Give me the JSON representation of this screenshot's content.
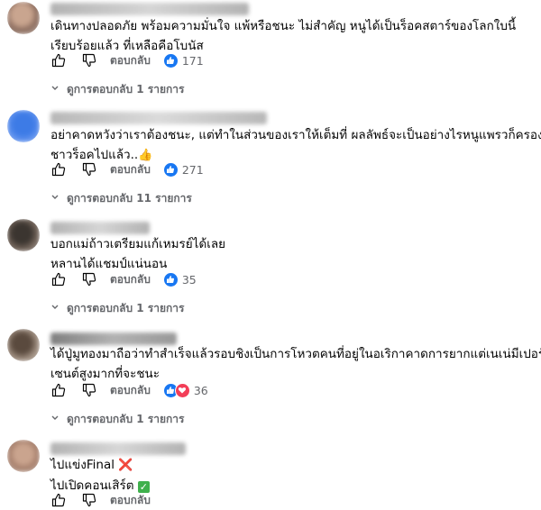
{
  "reply_label": "ตอบกลับ",
  "comments": [
    {
      "text_lines": [
        "เดินทางปลอดภัย พร้อมความมั่นใจ แพ้หรือชนะ ไม่สำคัญ หนูได้เป็นร็อคสตาร์ของโลกใบนี้",
        "เรียบร้อยแล้ว ที่เหลือคือโบนัส"
      ],
      "reaction_count": "171",
      "view_replies": "ดูการตอบกลับ 1 รายการ"
    },
    {
      "text_lines": [
        "อย่าคาดหวังว่าเราต้องชนะ, แต่ทำในส่วนของเราให้เต็มที่ ผลลัพธ์จะเป็นอย่างไรหนูแพรวก็ครองใจ",
        "ชาวร็อคไปแล้ว.."
      ],
      "reaction_count": "271",
      "view_replies": "ดูการตอบกลับ 11 รายการ"
    },
    {
      "text_lines": [
        "บอกแม่ถ้าวเตรียมแก้เหมรย์ได้เลย",
        "หลานได้แชมป์แน่นอน"
      ],
      "reaction_count": "35",
      "view_replies": "ดูการตอบกลับ 1 รายการ"
    },
    {
      "text_lines": [
        "ได้ปู่มูทองมาถือว่าทำสำเร็จแล้วรอบชิงเป็นการโหวตคนที่อยู่ในอเริกาคาดการยากแต่เนเน่มีเปอร์",
        "เซนต์สูงมากที่จะชนะ"
      ],
      "reaction_count": "36",
      "view_replies": "ดูการตอบกลับ 1 รายการ"
    },
    {
      "text_lines": [
        "ไปแข่งFinal",
        "ไปเปิดคอนเสิร์ต"
      ],
      "reaction_count": "",
      "view_replies": ""
    }
  ],
  "icons": {
    "like": "thumbs-up-outline-icon",
    "dislike": "thumbs-down-outline-icon",
    "reaction_like": "like-reaction-icon",
    "reaction_love": "love-reaction-icon",
    "chevron": "reply-arrow-icon",
    "emoji_thumb": "👍",
    "emoji_x": "❌",
    "emoji_check": "✅"
  },
  "colors": {
    "meta_gray": "#65676b",
    "like_blue": "#1877f2",
    "love_red": "#f33e58"
  }
}
